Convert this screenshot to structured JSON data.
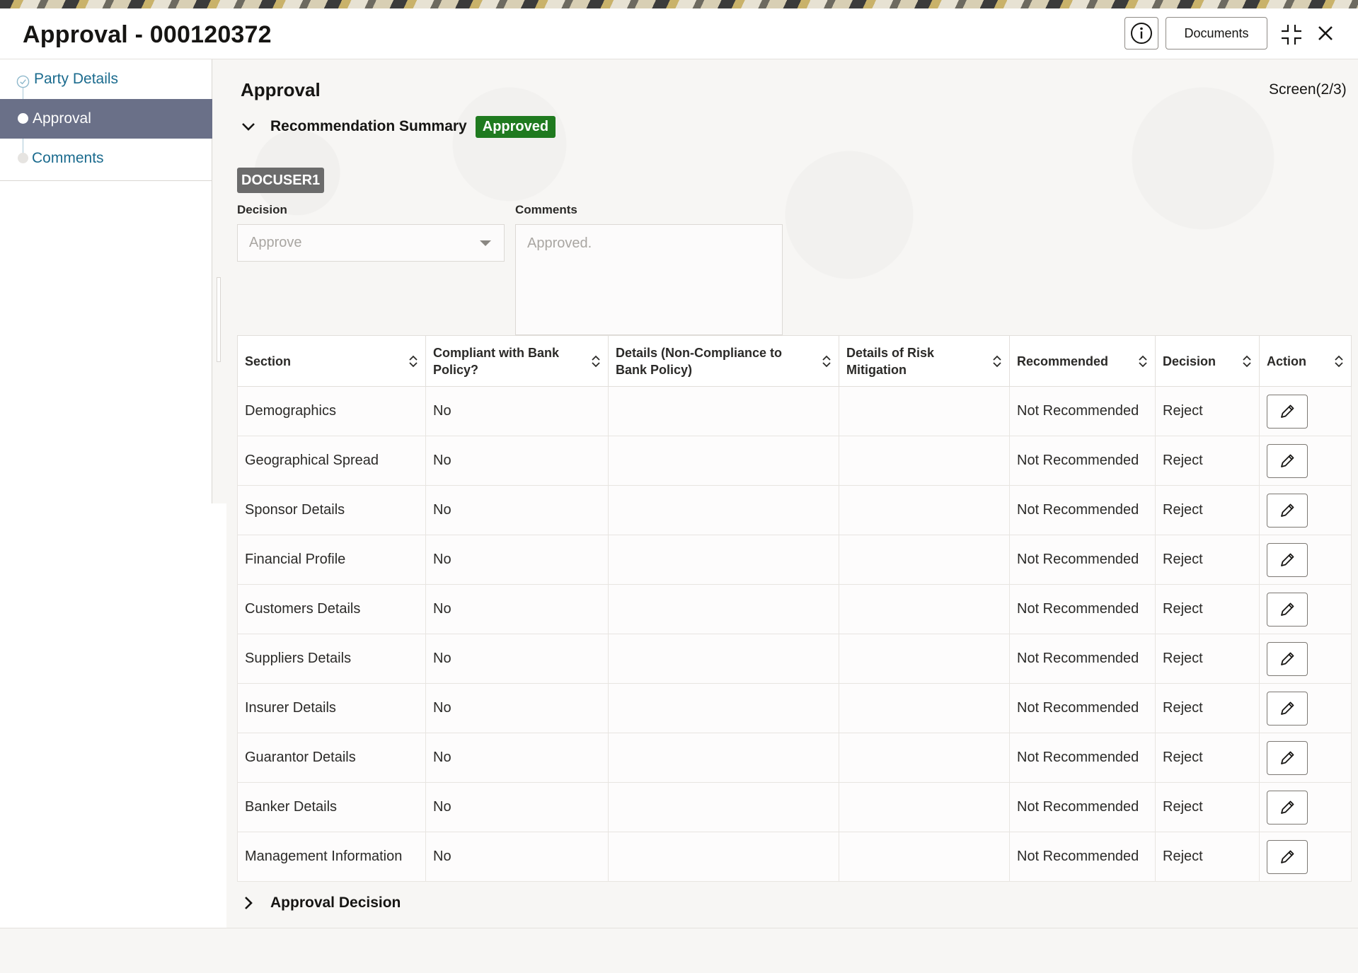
{
  "window": {
    "title": "Approval - 000120372",
    "documents_label": "Documents"
  },
  "sidebar": {
    "items": [
      {
        "label": "Party Details",
        "state": "completed"
      },
      {
        "label": "Approval",
        "state": "active"
      },
      {
        "label": "Comments",
        "state": "pending"
      }
    ]
  },
  "main": {
    "page_title": "Approval",
    "screen_indicator": "Screen(2/3)",
    "recommendation_summary": {
      "title": "Recommendation Summary",
      "status_badge": "Approved",
      "user": "DOCUSER1",
      "decision_label": "Decision",
      "decision_value": "Approve",
      "comments_label": "Comments",
      "comments_value": "Approved."
    },
    "table": {
      "headers": [
        "Section",
        "Compliant with Bank Policy?",
        "Details (Non-Compliance to Bank Policy)",
        "Details of Risk Mitigation",
        "Recommended",
        "Decision",
        "Action"
      ],
      "rows": [
        {
          "section": "Demographics",
          "compliant": "No",
          "details_non_compliance": "",
          "risk_mitigation": "",
          "recommended": "Not Recommended",
          "decision": "Reject"
        },
        {
          "section": "Geographical Spread",
          "compliant": "No",
          "details_non_compliance": "",
          "risk_mitigation": "",
          "recommended": "Not Recommended",
          "decision": "Reject"
        },
        {
          "section": "Sponsor Details",
          "compliant": "No",
          "details_non_compliance": "",
          "risk_mitigation": "",
          "recommended": "Not Recommended",
          "decision": "Reject"
        },
        {
          "section": "Financial Profile",
          "compliant": "No",
          "details_non_compliance": "",
          "risk_mitigation": "",
          "recommended": "Not Recommended",
          "decision": "Reject"
        },
        {
          "section": "Customers Details",
          "compliant": "No",
          "details_non_compliance": "",
          "risk_mitigation": "",
          "recommended": "Not Recommended",
          "decision": "Reject"
        },
        {
          "section": "Suppliers Details",
          "compliant": "No",
          "details_non_compliance": "",
          "risk_mitigation": "",
          "recommended": "Not Recommended",
          "decision": "Reject"
        },
        {
          "section": "Insurer Details",
          "compliant": "No",
          "details_non_compliance": "",
          "risk_mitigation": "",
          "recommended": "Not Recommended",
          "decision": "Reject"
        },
        {
          "section": "Guarantor Details",
          "compliant": "No",
          "details_non_compliance": "",
          "risk_mitigation": "",
          "recommended": "Not Recommended",
          "decision": "Reject"
        },
        {
          "section": "Banker Details",
          "compliant": "No",
          "details_non_compliance": "",
          "risk_mitigation": "",
          "recommended": "Not Recommended",
          "decision": "Reject"
        },
        {
          "section": "Management Information",
          "compliant": "No",
          "details_non_compliance": "",
          "risk_mitigation": "",
          "recommended": "Not Recommended",
          "decision": "Reject"
        }
      ]
    },
    "approval_decision": {
      "title": "Approval Decision"
    }
  },
  "icons": {
    "info": "info-icon",
    "minimize": "minimize-icon",
    "close": "close-icon",
    "sort": "sort-icon",
    "edit": "pencil-icon",
    "expand": "chevron-down-icon",
    "collapse": "chevron-right-icon",
    "completed_step": "check-circle-icon"
  },
  "colors": {
    "active_nav_bg": "#6a7088",
    "link": "#1b6b8e",
    "approved_badge": "#1f7a1f",
    "user_chip": "#6b6b6b"
  }
}
